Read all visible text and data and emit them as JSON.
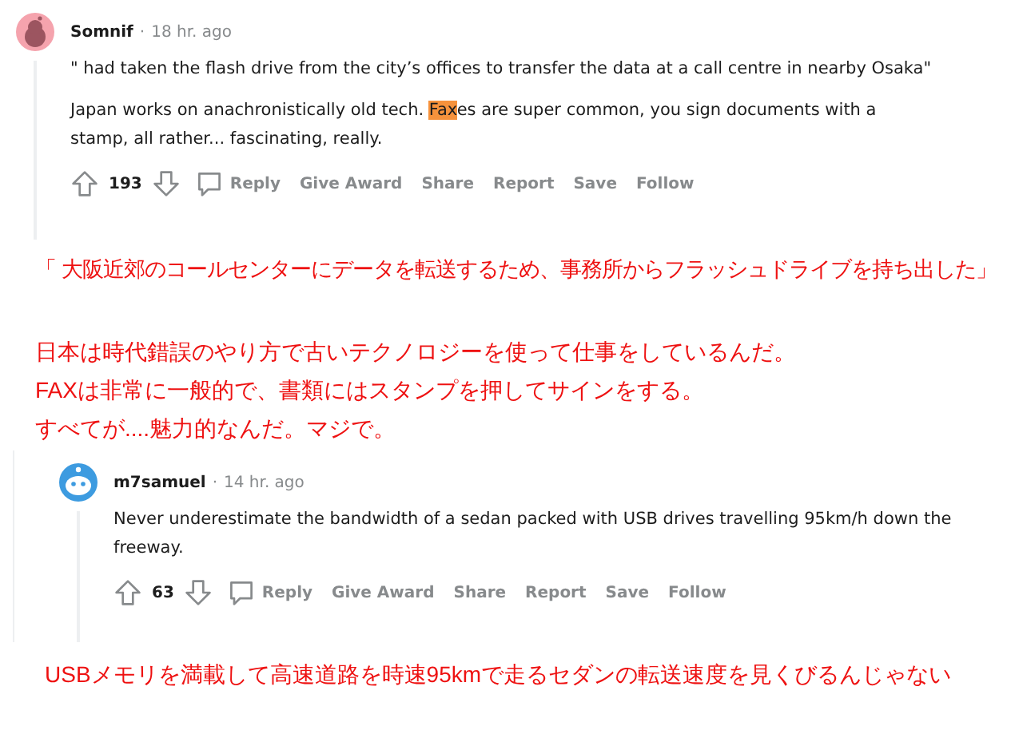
{
  "blocks": [
    {
      "kind": "comment",
      "author": "Somnif",
      "separator": "·",
      "time": "18 hr. ago",
      "paragraphs": [
        [
          {
            "text": "\" had taken the flash drive from the city’s offices to transfer the data at a call centre in nearby Osaka\"",
            "highlighted": false
          }
        ],
        [
          {
            "text": "Japan works on anachronistically old tech. ",
            "highlighted": false
          },
          {
            "text": "Fax",
            "highlighted": true
          },
          {
            "text": "es are super common, you sign documents with a stamp, all rather... fascinating, really.",
            "highlighted": false
          }
        ]
      ],
      "score": "193",
      "actions": [
        "Reply",
        "Give Award",
        "Share",
        "Report",
        "Save",
        "Follow"
      ]
    },
    {
      "kind": "translation",
      "lines": [
        "「 大阪近郊のコールセンターにデータを転送するため、事務所からフラッシュドライブを持ち出した」"
      ]
    },
    {
      "kind": "translation",
      "lines": [
        "日本は時代錯誤のやり方で古いテクノロジーを使って仕事をしているんだ。",
        "FAXは非常に一般的で、書類にはスタンプを押してサインをする。",
        "すべてが....魅力的なんだ。マジで。"
      ]
    },
    {
      "kind": "reply",
      "author": "m7samuel",
      "separator": "·",
      "time": "14 hr. ago",
      "paragraphs": [
        [
          {
            "text": "Never underestimate the bandwidth of a sedan packed with USB drives travelling 95km/h down the freeway.",
            "highlighted": false
          }
        ]
      ],
      "score": "63",
      "actions": [
        "Reply",
        "Give Award",
        "Share",
        "Report",
        "Save",
        "Follow"
      ]
    },
    {
      "kind": "translation",
      "lines": [
        "USBメモリを満載して高速道路を時速95kmで走るセダンの転送速度を見くびるんじゃない"
      ]
    }
  ]
}
